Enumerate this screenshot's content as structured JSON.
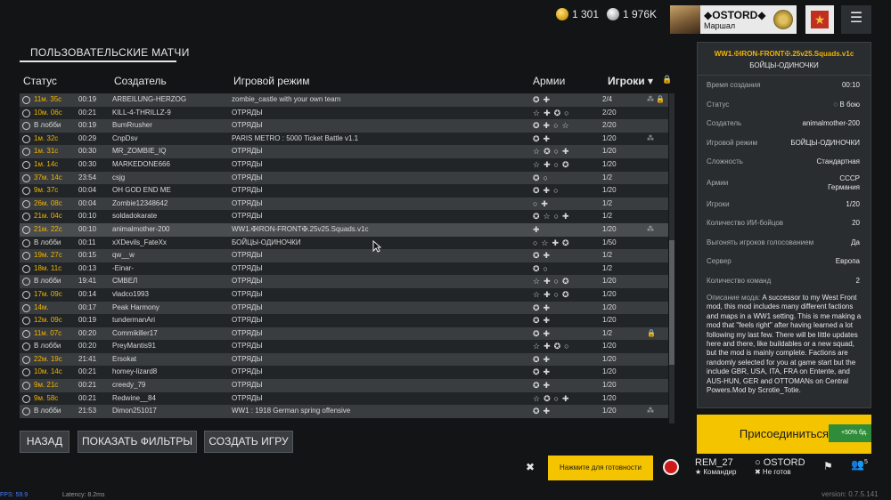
{
  "currency": {
    "gold": "1 301",
    "silver": "1 976K"
  },
  "profile": {
    "name": "◆OSTORD◆",
    "rank": "Маршал"
  },
  "menu_icon": "☰",
  "page_title": "ПОЛЬЗОВАТЕЛЬСКИЕ МАТЧИ",
  "columns": {
    "status": "Статус",
    "creator": "Создатель",
    "mode": "Игровой режим",
    "armies": "Армии",
    "players": "Игроки ▾",
    "lock": "🔒"
  },
  "rows": [
    {
      "status": "11м. 35с",
      "time": "00:19",
      "creator": "ARBEILUNG-HERZOG",
      "mode": "zombie_castle with your own team",
      "armies": "✪✚",
      "players": "2/4",
      "extra": "⁂ 🔒"
    },
    {
      "status": "10м. 06с",
      "time": "00:21",
      "creator": "KILL-4-THRILLZ-9",
      "mode": "ОТРЯДЫ",
      "armies": "☆✚✪○",
      "players": "2/20",
      "extra": ""
    },
    {
      "status": "В лобби",
      "time": "00:19",
      "creator": "BumRrusher",
      "mode": "ОТРЯДЫ",
      "armies": "✪✚○☆",
      "players": "2/20",
      "extra": ""
    },
    {
      "status": "1м. 32с",
      "time": "00:29",
      "creator": "CnpDsv",
      "mode": "PARIS METRO : 5000 Ticket Battle v1.1",
      "armies": "✪✚",
      "players": "1/20",
      "extra": "⁂"
    },
    {
      "status": "1м. 31с",
      "time": "00:30",
      "creator": "MR_ZOMBIE_IQ",
      "mode": "ОТРЯДЫ",
      "armies": "☆✪○✚",
      "players": "1/20",
      "extra": ""
    },
    {
      "status": "1м. 14с",
      "time": "00:30",
      "creator": "MARKEDONE666",
      "mode": "ОТРЯДЫ",
      "armies": "☆✚○✪",
      "players": "1/20",
      "extra": ""
    },
    {
      "status": "37м. 14с",
      "time": "23:54",
      "creator": "csjg",
      "mode": "ОТРЯДЫ",
      "armies": "✪○",
      "players": "1/2",
      "extra": ""
    },
    {
      "status": "9м. 37с",
      "time": "00:04",
      "creator": "OH GOD END ME",
      "mode": "ОТРЯДЫ",
      "armies": "✪✚○",
      "players": "1/20",
      "extra": ""
    },
    {
      "status": "26м. 08с",
      "time": "00:04",
      "creator": "Zombie12348642",
      "mode": "ОТРЯДЫ",
      "armies": "○✚",
      "players": "1/2",
      "extra": ""
    },
    {
      "status": "21м. 04с",
      "time": "00:10",
      "creator": "soldadokarate",
      "mode": "ОТРЯДЫ",
      "armies": "✪☆○✚",
      "players": "1/2",
      "extra": ""
    },
    {
      "status": "21м. 22с",
      "time": "00:10",
      "creator": "animalmother-200",
      "mode": "WW1.✠IRON-FRONT✠.25v25.Squads.v1c",
      "armies": "✚",
      "players": "1/20",
      "extra": "⁂"
    },
    {
      "status": "В лобби",
      "time": "00:11",
      "creator": "xXDevils_FateXx",
      "mode": "БОЙЦЫ-ОДИНОЧКИ",
      "armies": "○☆✚✪",
      "players": "1/50",
      "extra": ""
    },
    {
      "status": "19м. 27с",
      "time": "00:15",
      "creator": "qw__w",
      "mode": "ОТРЯДЫ",
      "armies": "✪✚",
      "players": "1/2",
      "extra": ""
    },
    {
      "status": "18м. 11с",
      "time": "00:13",
      "creator": "-Einar-",
      "mode": "ОТРЯДЫ",
      "armies": "✪○",
      "players": "1/2",
      "extra": ""
    },
    {
      "status": "В лобби",
      "time": "19:41",
      "creator": "СМВЕЛ",
      "mode": "ОТРЯДЫ",
      "armies": "☆✚○✪",
      "players": "1/20",
      "extra": ""
    },
    {
      "status": "17м. 09с",
      "time": "00:14",
      "creator": "vladco1993",
      "mode": "ОТРЯДЫ",
      "armies": "☆✚○✪",
      "players": "1/20",
      "extra": ""
    },
    {
      "status": "14м.",
      "time": "00:17",
      "creator": "Peak Harmony",
      "mode": "ОТРЯДЫ",
      "armies": "✪✚",
      "players": "1/20",
      "extra": ""
    },
    {
      "status": "12м. 09с",
      "time": "00:19",
      "creator": "tundermanAri",
      "mode": "ОТРЯДЫ",
      "armies": "✪✚",
      "players": "1/20",
      "extra": ""
    },
    {
      "status": "11м. 07с",
      "time": "00:20",
      "creator": "Commikiller17",
      "mode": "ОТРЯДЫ",
      "armies": "✪✚",
      "players": "1/2",
      "extra": "🔒"
    },
    {
      "status": "В лобби",
      "time": "00:20",
      "creator": "PreyMantis91",
      "mode": "ОТРЯДЫ",
      "armies": "☆✚✪○",
      "players": "1/20",
      "extra": ""
    },
    {
      "status": "22м. 19с",
      "time": "21:41",
      "creator": "Ersokat",
      "mode": "ОТРЯДЫ",
      "armies": "✪✚",
      "players": "1/20",
      "extra": ""
    },
    {
      "status": "10м. 14с",
      "time": "00:21",
      "creator": "homey-lizard8",
      "mode": "ОТРЯДЫ",
      "armies": "✪✚",
      "players": "1/20",
      "extra": ""
    },
    {
      "status": "9м. 21с",
      "time": "00:21",
      "creator": "creedy_79",
      "mode": "ОТРЯДЫ",
      "armies": "✪✚",
      "players": "1/20",
      "extra": ""
    },
    {
      "status": "9м. 58с",
      "time": "00:21",
      "creator": "Redwine__84",
      "mode": "ОТРЯДЫ",
      "armies": "☆✪○✚",
      "players": "1/20",
      "extra": ""
    },
    {
      "status": "В лобби",
      "time": "21:53",
      "creator": "Dimon251017",
      "mode": "WW1 : 1918 German spring offensive",
      "armies": "✪✚",
      "players": "1/20",
      "extra": "⁂"
    }
  ],
  "buttons": {
    "back": "НАЗАД",
    "filters": "ПОКАЗАТЬ ФИЛЬТРЫ",
    "create": "СОЗДАТЬ ИГРУ"
  },
  "panel": {
    "title": "WW1.✠IRON-FRONT✠.25v25.Squads.v1c",
    "subtitle": "БОЙЦЫ-ОДИНОЧКИ",
    "rows": [
      {
        "label": "Время создания",
        "value": "00:10"
      },
      {
        "label": "Статус",
        "value": "◌ В бою"
      },
      {
        "label": "Создатель",
        "value": "animalmother-200"
      },
      {
        "label": "Игровой режим",
        "value": "БОЙЦЫ-ОДИНОЧКИ"
      },
      {
        "label": "Сложность",
        "value": "Стандартная"
      }
    ],
    "armies_label": "Армии",
    "armies_1": "СССР",
    "armies_2": "Германия",
    "rows2": [
      {
        "label": "Игроки",
        "value": "1/20"
      },
      {
        "label": "Количество ИИ-бойцов",
        "value": "20"
      },
      {
        "label": "Выгонять игроков голосованием",
        "value": "Да"
      },
      {
        "label": "Сервер",
        "value": "Европа"
      },
      {
        "label": "Количество команд",
        "value": "2"
      }
    ],
    "desc_label": "Описание мода:",
    "desc": "A successor to my West Front mod, this mod includes many different factions and maps in a WW1 setting. This is me making a mod that \"feels right\" after having learned a lot following my last few. There will be little updates here and there, like buildables or a new squad, but the mod is mainly complete. Factions are randomly selected for you at game start but the include GBR, USA, ITA, FRA on Entente, and AUS-HUN, GER and OTTOMANs on Central Powers.Mod by Scrotie_Totie."
  },
  "join": "Присоединиться",
  "xp_badge": "+50% бд.",
  "ready": "Нажмите для готовности",
  "close_icon": "✖",
  "players": [
    {
      "name": "REM_27",
      "status": "★ Командир"
    },
    {
      "name": "○ OSTORD",
      "status": "✖ Не готов"
    }
  ],
  "flag_icon": "⚑",
  "people_icon": "👥",
  "people_count": "5",
  "fps": "FPS: 59.9",
  "latency": "Latency: 8.2ms",
  "version": "version: 0.7.5.141"
}
